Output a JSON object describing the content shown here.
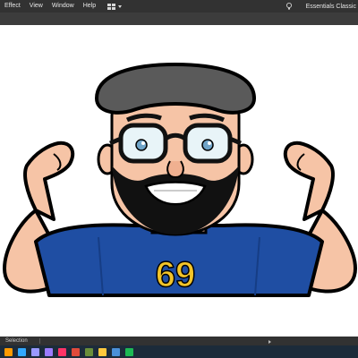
{
  "menubar": {
    "items": [
      "Effect",
      "View",
      "Window",
      "Help"
    ],
    "workspace_label": "Essentials Classic",
    "icons": [
      "workspace-switcher-icon",
      "lightbulb-icon"
    ]
  },
  "statusbar": {
    "tool": "Selection"
  },
  "artwork": {
    "jersey_number": "69",
    "colors": {
      "jersey": "#1f4ea3",
      "number": "#f2c42a",
      "skin": "#f6c4a6",
      "skin_shadow": "#e79a85",
      "beard": "#111111",
      "hat": "#5a5a5a",
      "glasses": "#111111",
      "lens": "#e8f4f8"
    }
  },
  "taskbar": {
    "apps": [
      {
        "name": "illustrator-app-icon",
        "color": "#ff9a00"
      },
      {
        "name": "photoshop-app-icon",
        "color": "#31a8ff"
      },
      {
        "name": "premiere-app-icon",
        "color": "#9999ff"
      },
      {
        "name": "aftereffects-app-icon",
        "color": "#9b7bff"
      },
      {
        "name": "indesign-app-icon",
        "color": "#ff3366"
      },
      {
        "name": "app-icon-6",
        "color": "#e04a3b"
      },
      {
        "name": "app-icon-7",
        "color": "#6a8e3a"
      },
      {
        "name": "app-icon-8",
        "color": "#ffc83d"
      },
      {
        "name": "app-icon-9",
        "color": "#4a90d9"
      },
      {
        "name": "app-icon-10",
        "color": "#1db954"
      }
    ]
  }
}
